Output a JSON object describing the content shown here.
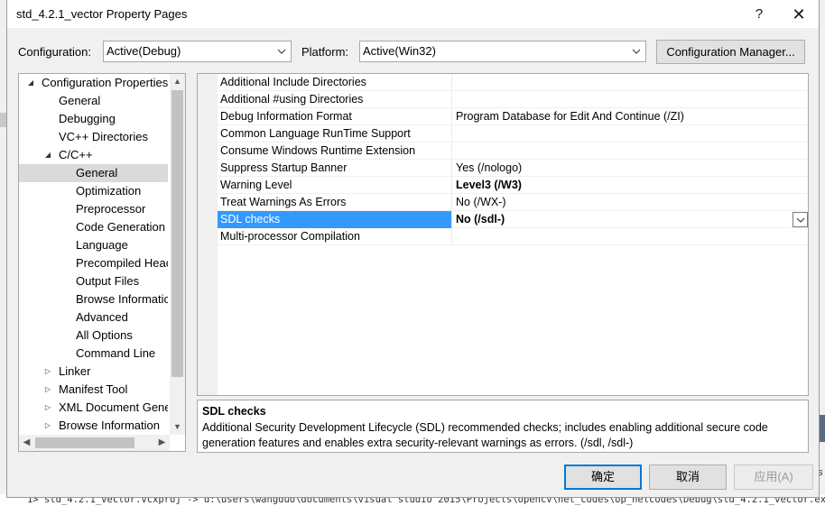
{
  "window": {
    "title": "std_4.2.1_vector Property Pages",
    "help_label": "?",
    "close_label": "✕"
  },
  "config_bar": {
    "configuration_label": "Configuration:",
    "configuration_value": "Active(Debug)",
    "platform_label": "Platform:",
    "platform_value": "Active(Win32)",
    "manager_button": "Configuration Manager..."
  },
  "tree": {
    "items": [
      {
        "label": "Configuration Properties",
        "glyph": "◢",
        "expanded": true
      },
      {
        "label": "General"
      },
      {
        "label": "Debugging"
      },
      {
        "label": "VC++ Directories"
      },
      {
        "label": "C/C++",
        "glyph": "◢",
        "expanded": true
      },
      {
        "label": "General",
        "selected": true
      },
      {
        "label": "Optimization"
      },
      {
        "label": "Preprocessor"
      },
      {
        "label": "Code Generation"
      },
      {
        "label": "Language"
      },
      {
        "label": "Precompiled Heac"
      },
      {
        "label": "Output Files"
      },
      {
        "label": "Browse Informatic"
      },
      {
        "label": "Advanced"
      },
      {
        "label": "All Options"
      },
      {
        "label": "Command Line"
      },
      {
        "label": "Linker",
        "glyph": "▷"
      },
      {
        "label": "Manifest Tool",
        "glyph": "▷"
      },
      {
        "label": "XML Document Gene",
        "glyph": "▷"
      },
      {
        "label": "Browse Information",
        "glyph": "▷"
      }
    ]
  },
  "properties": {
    "rows": [
      {
        "name": "Additional Include Directories",
        "value": ""
      },
      {
        "name": "Additional #using Directories",
        "value": ""
      },
      {
        "name": "Debug Information Format",
        "value": "Program Database for Edit And Continue (/ZI)"
      },
      {
        "name": "Common Language RunTime Support",
        "value": ""
      },
      {
        "name": "Consume Windows Runtime Extension",
        "value": ""
      },
      {
        "name": "Suppress Startup Banner",
        "value": "Yes (/nologo)"
      },
      {
        "name": "Warning Level",
        "value": "Level3 (/W3)",
        "bold": true
      },
      {
        "name": "Treat Warnings As Errors",
        "value": "No (/WX-)"
      },
      {
        "name": "SDL checks",
        "value": "No (/sdl-)",
        "bold": true,
        "selected": true
      },
      {
        "name": "Multi-processor Compilation",
        "value": ""
      }
    ]
  },
  "description": {
    "title": "SDL checks",
    "text": "Additional Security Development Lifecycle (SDL) recommended checks; includes enabling additional secure code generation features and enables extra security-relevant warnings as errors.     (/sdl, /sdl-)"
  },
  "buttons": {
    "ok": "确定",
    "cancel": "取消",
    "apply": "应用(A)"
  },
  "background": {
    "output_line": "1>  std_4.2.1_vector.vcxproj -> d:\\users\\wangduo\\documents\\visual studio 2015\\Projects\\opencv\\net_codes\\op_netcodes\\Debug\\std_4.2.1_vector.exe",
    "right_edge_text": "s"
  },
  "colors": {
    "selection_blue": "#3399ff",
    "primary_border": "#0078d7",
    "tree_selected": "#dadada"
  }
}
